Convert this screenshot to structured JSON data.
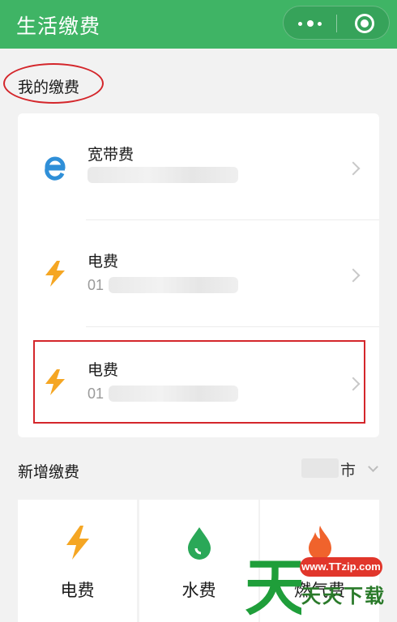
{
  "header": {
    "title": "生活缴费",
    "menu_icon": "more-dots-icon",
    "close_icon": "target-close-icon",
    "bg_color": "#3fb465"
  },
  "my_bills": {
    "section_title": "我的缴费",
    "items": [
      {
        "label": "宽带费",
        "sub_visible": "",
        "icon": "ie-browser-icon"
      },
      {
        "label": "电费",
        "sub_visible": "01",
        "icon": "lightning-icon"
      },
      {
        "label": "电费",
        "sub_visible": "01",
        "icon": "lightning-icon"
      }
    ]
  },
  "add_bill": {
    "section_title": "新增缴费",
    "city_suffix": "市",
    "categories": [
      {
        "label": "电费",
        "icon": "lightning-icon"
      },
      {
        "label": "水费",
        "icon": "water-drop-icon"
      },
      {
        "label": "燃气费",
        "icon": "flame-icon"
      }
    ]
  },
  "watermark": {
    "url": "www.TTzip.com",
    "text": "天天下载",
    "big_char": "天"
  },
  "colors": {
    "accent_green": "#3fb465",
    "lightning": "#f5a623",
    "annotation_red": "#d4262b"
  }
}
